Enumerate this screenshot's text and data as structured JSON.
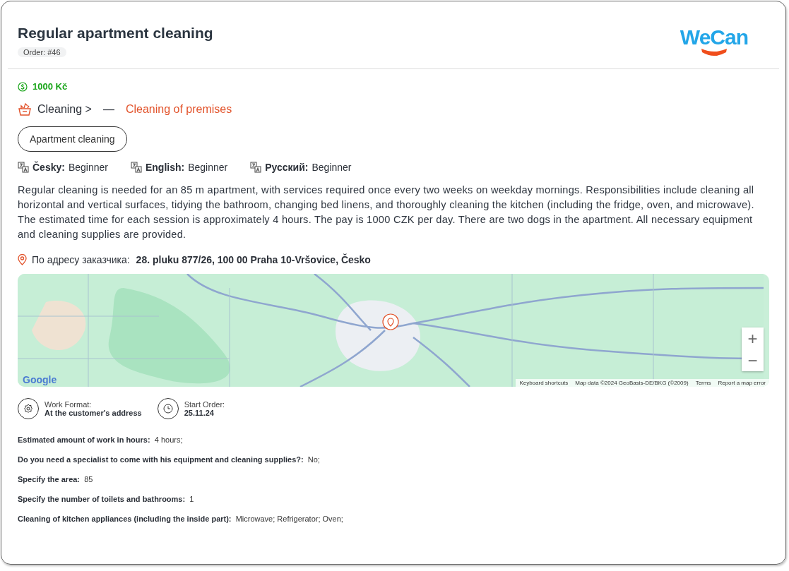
{
  "header": {
    "title": "Regular apartment cleaning",
    "order": "Order: #46",
    "logo": "WeCan"
  },
  "price": "1000 Kč",
  "category": {
    "parent": "Cleaning >",
    "separator": "—",
    "child": "Cleaning of premises"
  },
  "tags": [
    "Apartment cleaning"
  ],
  "languages": [
    {
      "name": "Česky:",
      "level": "Beginner"
    },
    {
      "name": "English:",
      "level": "Beginner"
    },
    {
      "name": "Русский:",
      "level": "Beginner"
    }
  ],
  "description": "Regular cleaning is needed for an 85 m apartment, with services required once every two weeks on weekday mornings. Responsibilities include cleaning all horizontal and vertical surfaces, tidying the bathroom, changing bed linens, and thoroughly cleaning the kitchen (including the fridge, oven, and microwave). The estimated time for each session is approximately 4 hours. The pay is 1000 CZK per day. There are two dogs in the apartment. All necessary equipment and cleaning supplies are provided.",
  "address": {
    "label": "По адресу заказчика:",
    "value": "28. pluku 877/26, 100 00 Praha 10-Vršovice, Česko"
  },
  "map": {
    "logo": "Google",
    "zoom_in": "+",
    "zoom_out": "−",
    "footer": [
      "Keyboard shortcuts",
      "Map data ©2024 GeoBasis-DE/BKG (©2009)",
      "Terms",
      "Report a map error"
    ]
  },
  "info": [
    {
      "kind": "format",
      "label": "Work Format:",
      "value": "At the customer's address"
    },
    {
      "kind": "date",
      "label": "Start Order:",
      "value": "25.11.24"
    }
  ],
  "details": [
    {
      "label": "Estimated amount of work in hours:",
      "value": "4 hours;"
    },
    {
      "label": "Do you need a specialist to come with his equipment and cleaning supplies?:",
      "value": "No;"
    },
    {
      "label": "Specify the area:",
      "value": "85"
    },
    {
      "label": "Specify the number of toilets and bathrooms:",
      "value": "1"
    },
    {
      "label": "Cleaning of kitchen appliances (including the inside part):",
      "value": "Microwave; Refrigerator; Oven;"
    }
  ]
}
